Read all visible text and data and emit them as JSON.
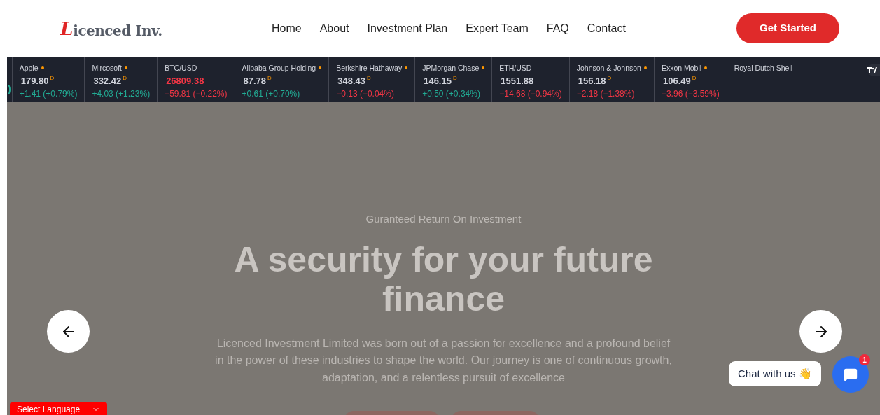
{
  "header": {
    "logo_mark": "L",
    "logo_text": "icenced Inv.",
    "nav": [
      {
        "label": "Home"
      },
      {
        "label": "About"
      },
      {
        "label": "Investment Plan"
      },
      {
        "label": "Expert Team"
      },
      {
        "label": "FAQ"
      },
      {
        "label": "Contact"
      }
    ],
    "cta": "Get Started"
  },
  "ticker": {
    "items": [
      {
        "change": ")"
      },
      {
        "name": "Apple",
        "dot": true,
        "price": "179.80",
        "delayed_mark": "D",
        "change": "+1.41 (+0.79%)",
        "color": "#22ab94"
      },
      {
        "name": "Mircosoft",
        "dot": true,
        "price": "332.42",
        "delayed_mark": "D",
        "change": "+4.03 (+1.23%)",
        "color": "#22ab94"
      },
      {
        "name": "BTC/USD",
        "price": "26809.38",
        "price_highlight": true,
        "change": "−59.81 (−0.22%)",
        "color": "#f23645"
      },
      {
        "name": "Alibaba Group Holding",
        "dot": true,
        "price": "87.78",
        "delayed_mark": "D",
        "change": "+0.61 (+0.70%)",
        "color": "#22ab94"
      },
      {
        "name": "Berkshire Hathaway",
        "dot": true,
        "price": "348.43",
        "delayed_mark": "D",
        "change": "−0.13 (−0.04%)",
        "color": "#f23645"
      },
      {
        "name": "JPMorgan Chase",
        "dot": true,
        "price": "146.15",
        "delayed_mark": "D",
        "change": "+0.50 (+0.34%)",
        "color": "#22ab94"
      },
      {
        "name": "ETH/USD",
        "price": "1551.88",
        "change": "−14.68 (−0.94%)",
        "color": "#f23645"
      },
      {
        "name": "Johnson & Johnson",
        "dot": true,
        "price": "156.18",
        "delayed_mark": "D",
        "change": "−2.18 (−1.38%)",
        "color": "#f23645"
      },
      {
        "name": "Exxon Mobil",
        "dot": true,
        "price": "106.49",
        "delayed_mark": "D",
        "change": "−3.96 (−3.59%)",
        "color": "#f23645"
      },
      {
        "name": "Royal Dutch Shell"
      }
    ]
  },
  "hero": {
    "eyebrow": "Guranteed Return On Investment",
    "title": "A security for your future finance",
    "text": "Licenced Investment Limited was born out of a passion for excellence and a profound belief in the power of these industries to shape the world. Our journey is one of continuous growth, adaptation, and a relentless pursuit of excellence"
  },
  "chat": {
    "label": "Chat with us",
    "emoji": "👋",
    "badge": "1"
  },
  "language": {
    "label": "Select Language"
  }
}
